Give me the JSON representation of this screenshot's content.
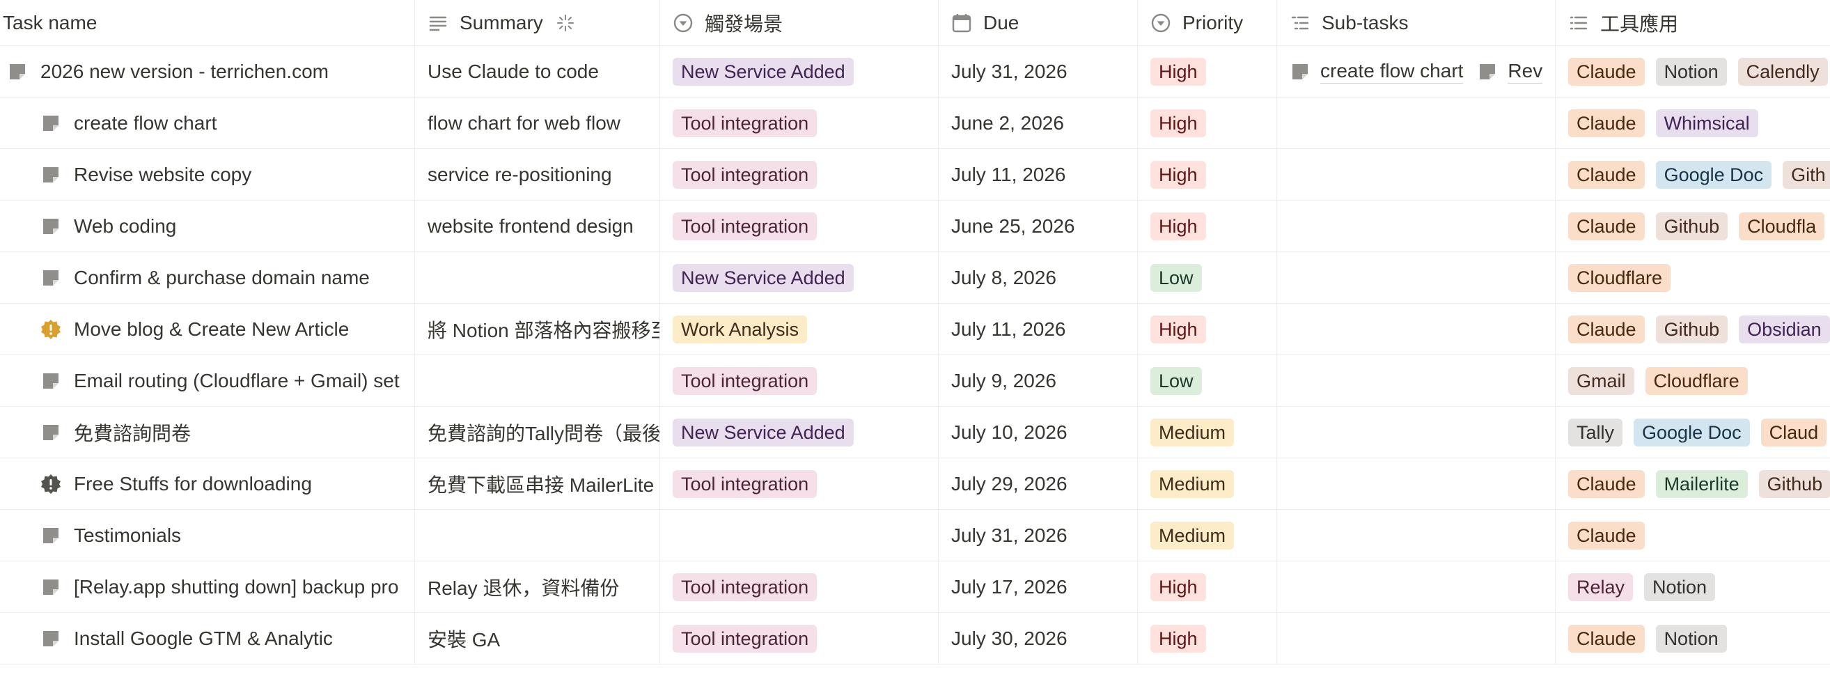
{
  "columns": {
    "task": "Task name",
    "summary": "Summary",
    "trigger": "觸發場景",
    "due": "Due",
    "priority": "Priority",
    "subtasks": "Sub-tasks",
    "tools": "工具應用"
  },
  "rows": [
    {
      "title": "2026 new version - terrichen.com",
      "summary": "Use Claude to code",
      "trigger": "New Service Added",
      "due": "July 31, 2026",
      "priority": "High",
      "subtasks": [
        "create flow chart",
        "Rev"
      ],
      "tools": [
        "Claude",
        "Notion",
        "Calendly"
      ]
    },
    {
      "title": "create flow chart",
      "summary": "flow chart for web flow",
      "trigger": "Tool integration",
      "due": "June 2, 2026",
      "priority": "High",
      "tools": [
        "Claude",
        "Whimsical"
      ]
    },
    {
      "title": "Revise website copy",
      "summary": "service re-positioning",
      "trigger": "Tool integration",
      "due": "July 11, 2026",
      "priority": "High",
      "tools": [
        "Claude",
        "Google Doc",
        "Gith"
      ]
    },
    {
      "title": "Web coding",
      "summary": "website frontend design",
      "trigger": "Tool integration",
      "due": "June 25, 2026",
      "priority": "High",
      "tools": [
        "Claude",
        "Github",
        "Cloudfla"
      ]
    },
    {
      "title": "Confirm & purchase domain name",
      "summary": "",
      "trigger": "New Service Added",
      "due": "July 8, 2026",
      "priority": "Low",
      "tools": [
        "Cloudflare"
      ]
    },
    {
      "title": "Move blog & Create New Article",
      "summary": "將 Notion 部落格內容搬移至",
      "trigger": "Work Analysis",
      "due": "July 11, 2026",
      "priority": "High",
      "tools": [
        "Claude",
        "Github",
        "Obsidian"
      ]
    },
    {
      "title": "Email routing (Cloudflare + Gmail) set",
      "summary": "",
      "trigger": "Tool integration",
      "due": "July 9, 2026",
      "priority": "Low",
      "tools": [
        "Gmail",
        "Cloudflare"
      ]
    },
    {
      "title": "免費諮詢問卷",
      "summary": "免費諮詢的Tally問卷（最後",
      "trigger": "New Service Added",
      "due": "July 10, 2026",
      "priority": "Medium",
      "tools": [
        "Tally",
        "Google Doc",
        "Claud"
      ]
    },
    {
      "title": "Free Stuffs for downloading",
      "summary": "免費下載區串接 MailerLite",
      "trigger": "Tool integration",
      "due": "July 29, 2026",
      "priority": "Medium",
      "tools": [
        "Claude",
        "Mailerlite",
        "Github"
      ]
    },
    {
      "title": "Testimonials",
      "summary": "",
      "trigger": "",
      "due": "July 31, 2026",
      "priority": "Medium",
      "tools": [
        "Claude"
      ]
    },
    {
      "title": "[Relay.app shutting down] backup pro",
      "summary": "Relay 退休，資料備份",
      "trigger": "Tool integration",
      "due": "July 17, 2026",
      "priority": "High",
      "tools": [
        "Relay",
        "Notion"
      ]
    },
    {
      "title": "Install Google GTM & Analytic",
      "summary": "安裝 GA",
      "trigger": "Tool integration",
      "due": "July 30, 2026",
      "priority": "High",
      "tools": [
        "Claude",
        "Notion"
      ]
    }
  ],
  "icons": {
    "page": "page-icon",
    "warning_orange": "warning-badge-orange-icon",
    "warning_dark": "warning-badge-dark-icon"
  },
  "colors": {
    "text": "#37352f",
    "muted": "#787774",
    "border": "#ededec"
  }
}
